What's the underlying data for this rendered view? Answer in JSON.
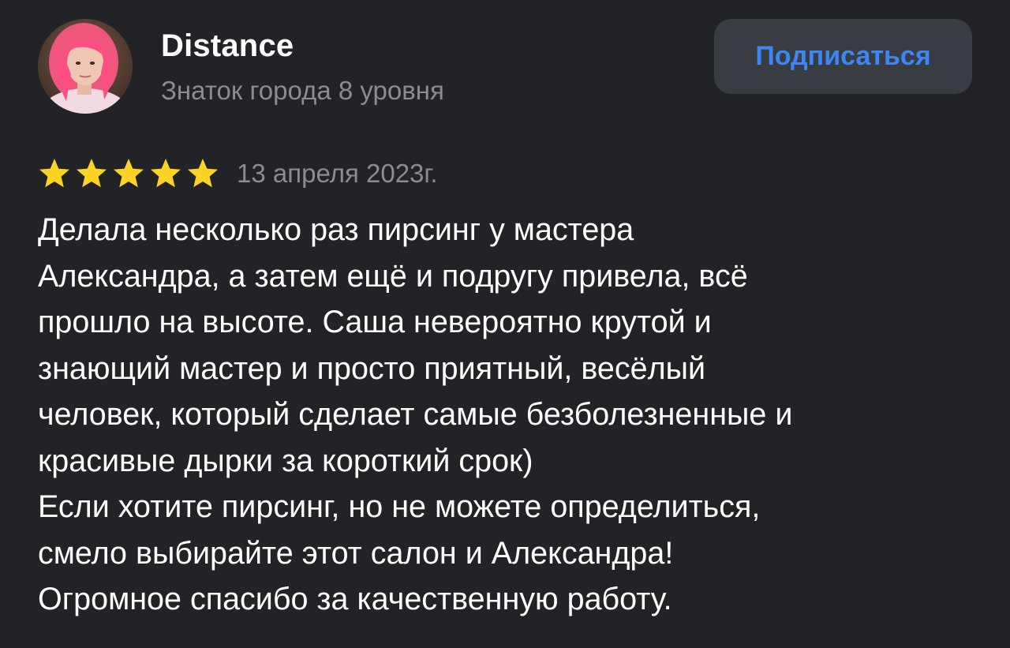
{
  "author": {
    "name": "Distance",
    "level": "Знаток города 8 уровня",
    "avatar_icon": "user-photo-avatar"
  },
  "actions": {
    "subscribe_label": "Подписаться"
  },
  "review": {
    "rating": 5,
    "rating_max": 5,
    "date": "13 апреля 2023г.",
    "lines": [
      "Делала несколько раз пирсинг у мастера",
      "Александра, а затем ещё и подругу привела, всё",
      "прошло на высоте. Саша невероятно крутой и",
      "знающий мастер и просто приятный, весёлый",
      "человек, который сделает самые безболезненные и",
      "красивые дырки за короткий срок)",
      "Если хотите пирсинг, но не можете определиться,",
      "смело выбирайте этот салон и Александра!",
      "Огромное спасибо за качественную работу."
    ]
  },
  "colors": {
    "background": "#222327",
    "star": "#fdd226",
    "accent": "#3d86f5",
    "button_bg": "#3a3c44",
    "muted_text": "#8b8c90"
  }
}
